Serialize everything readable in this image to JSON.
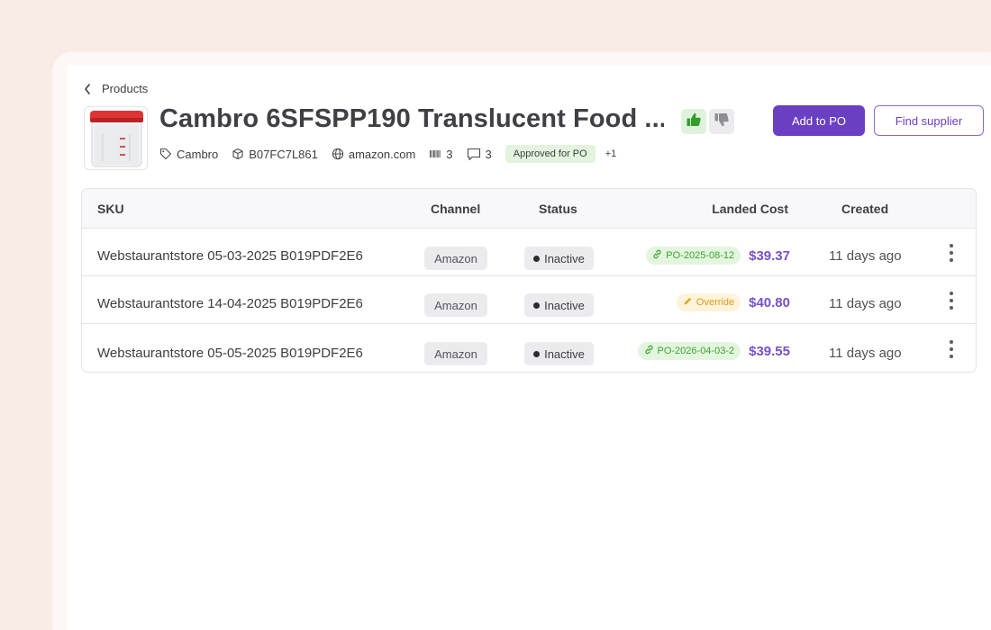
{
  "breadcrumb": {
    "label": "Products"
  },
  "product": {
    "title": "Cambro 6SFSPP190 Translucent Food ...",
    "brand": "Cambro",
    "asin": "B07FC7L861",
    "domain": "amazon.com",
    "barcode_count": "3",
    "comment_count": "3",
    "badge": "Approved for PO",
    "more_badges": "+1"
  },
  "actions": {
    "add_to_po": "Add to PO",
    "find_supplier": "Find supplier"
  },
  "table": {
    "columns": [
      "SKU",
      "Channel",
      "Status",
      "Landed Cost",
      "Created"
    ],
    "rows": [
      {
        "sku": "Webstaurantstore 05-03-2025 B019PDF2E6",
        "channel": "Amazon",
        "status": "Inactive",
        "tag": "PO-2025-08-12",
        "tag_type": "po",
        "cost": "$39.37",
        "created": "11 days ago"
      },
      {
        "sku": "Webstaurantstore 14-04-2025 B019PDF2E6",
        "channel": "Amazon",
        "status": "Inactive",
        "tag": "Override",
        "tag_type": "override",
        "cost": "$40.80",
        "created": "11 days ago"
      },
      {
        "sku": "Webstaurantstore 05-05-2025 B019PDF2E6",
        "channel": "Amazon",
        "status": "Inactive",
        "tag": "PO-2026-04-03-2",
        "tag_type": "po",
        "cost": "$39.55",
        "created": "11 days ago"
      }
    ]
  },
  "colors": {
    "background": "#f9ece7",
    "accent": "#6a3fc2",
    "po_tag_bg": "#e3f5df",
    "po_tag_text": "#3aa52e",
    "override_bg": "#fff3da",
    "override_text": "#d59c20",
    "cost_text": "#7651c9"
  },
  "icons": {
    "back": "chevron-left-icon",
    "brand": "tag-icon",
    "asin": "box-icon",
    "domain": "globe-icon",
    "barcode": "barcode-icon",
    "comments": "comment-icon",
    "vote_up": "thumbs-up-icon",
    "vote_down": "thumbs-down-icon",
    "po_link": "link-icon",
    "override": "pencil-icon",
    "row_menu": "kebab-menu-icon"
  }
}
